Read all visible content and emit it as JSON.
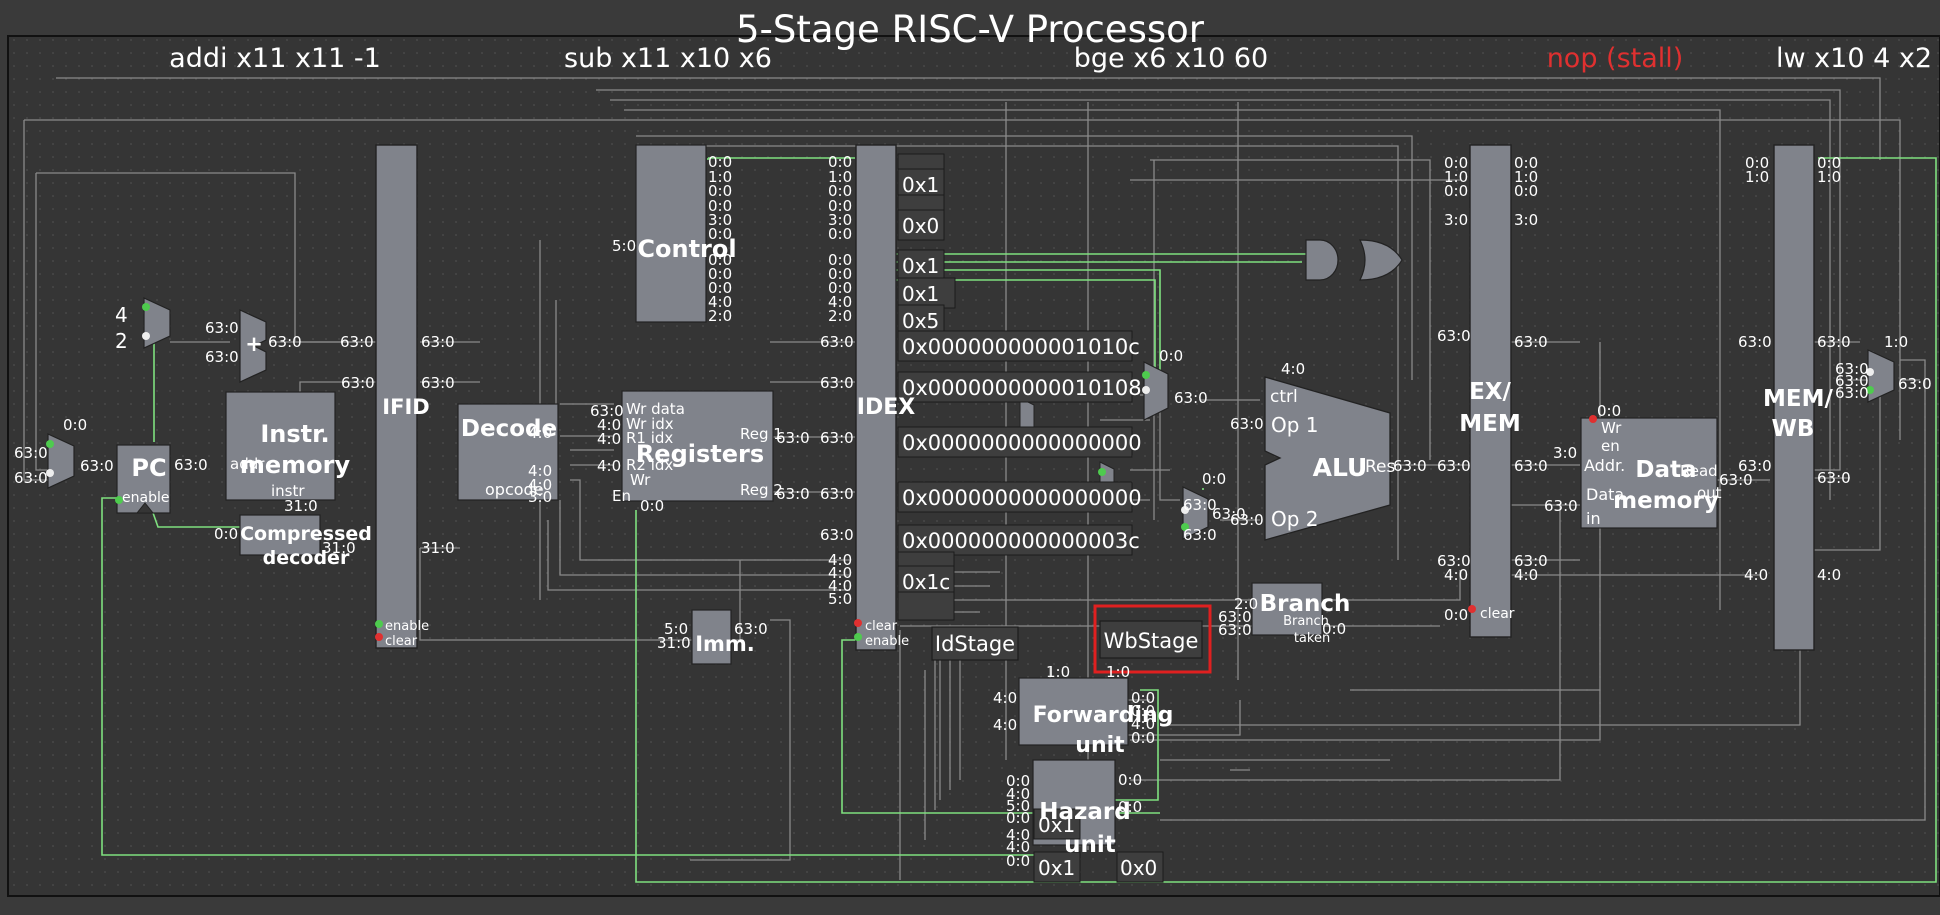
{
  "title": "5-Stage RISC-V Processor",
  "colors": {
    "background": "#3a3a3a",
    "canvas": "#353535",
    "block": "#80838b",
    "wire": "#8a8a8a",
    "active_wire": "#7fe07f",
    "stall_text": "#e03030",
    "highlight": "#e02020",
    "text": "#ffffff"
  },
  "stages": [
    {
      "id": "if",
      "instr": "addi x11 x11 -1",
      "stall": false
    },
    {
      "id": "id",
      "instr": "sub x11 x10 x6",
      "stall": false
    },
    {
      "id": "ex",
      "instr": "bge x6 x10 60",
      "stall": false
    },
    {
      "id": "mem",
      "instr": "nop (stall)",
      "stall": true
    },
    {
      "id": "wb",
      "instr": "lw x10 4 x2",
      "stall": false
    }
  ],
  "blocks": {
    "pc": "PC",
    "pc_enable": "enable",
    "instr_mem": "Instr.\nmemory",
    "instr_mem_addr": "addr",
    "instr_mem_instr": "instr",
    "compressed": "Compressed\ndecoder",
    "ifid": "IFID",
    "ifid_enable": "enable",
    "ifid_clear": "clear",
    "decode": "Decode",
    "decode_opcode": "opcode",
    "control": "Control",
    "registers": "Registers",
    "reg_ports": [
      "Wr data",
      "Wr idx",
      "R1 idx",
      "R2 idx",
      "Wr",
      "En",
      "Reg 1",
      "Reg 2"
    ],
    "imm": "Imm.",
    "idex": "IDEX",
    "idex_clear": "clear",
    "idex_enable": "enable",
    "alu": "ALU",
    "alu_ports": [
      "ctrl",
      "Op 1",
      "Op 2",
      "Res"
    ],
    "branch": "Branch",
    "branch_taken": "Branch\ntaken",
    "exmem": "EX/\nMEM",
    "exmem_clear": "clear",
    "data_mem": "Data\nmemory",
    "data_mem_ports": [
      "Wr",
      "en",
      "Addr.",
      "Data",
      "in",
      "Read",
      "out"
    ],
    "memwb": "MEM/\nWB",
    "forwarding": "Forwarding\nunit",
    "hazard": "Hazard\nunit",
    "id_stage": "IdStage",
    "wb_stage": "WbStage"
  },
  "constants": {
    "four": "4",
    "two": "2"
  },
  "probes_idex": [
    "0x1",
    "0x0",
    "0x1",
    "0x1",
    "0x5",
    "0x000000000001010c",
    "0x0000000000010108",
    "0x0000000000000000",
    "0x0000000000000000",
    "0x000000000000003c",
    "0x1c"
  ],
  "probes_hazard": [
    "0x1",
    "0x1",
    "0x0"
  ],
  "bit_labels": {
    "r630": "63:0",
    "r310": "31:0",
    "r00": "0:0",
    "r10": "1:0",
    "r30": "3:0",
    "r40": "4:0",
    "r50": "5:0",
    "r20": "2:0"
  }
}
